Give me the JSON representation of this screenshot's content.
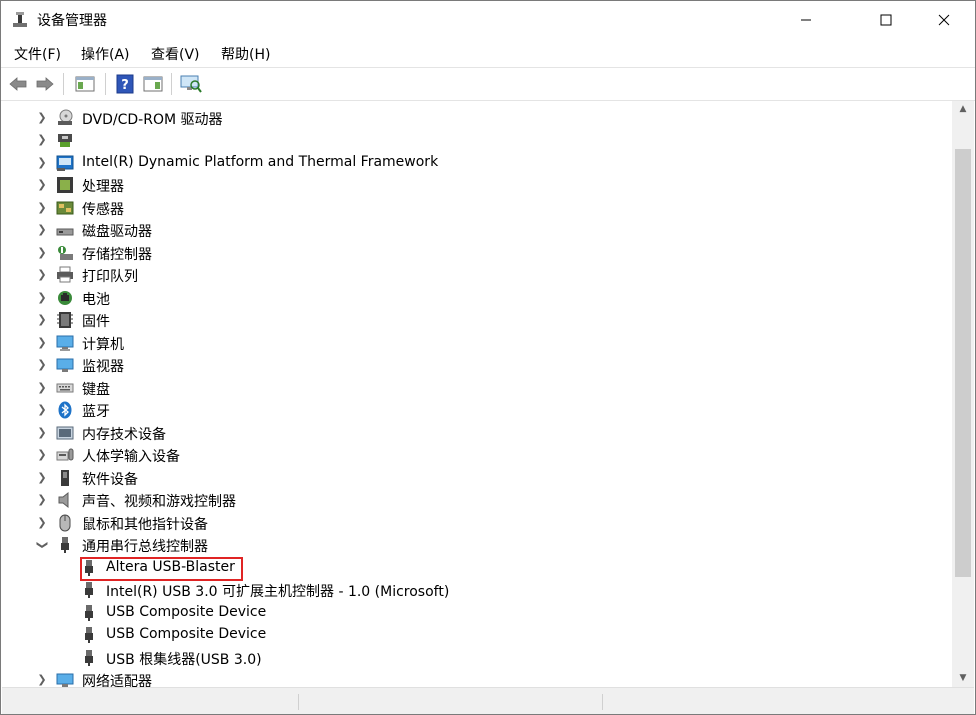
{
  "window": {
    "title": "设备管理器"
  },
  "menu": [
    {
      "label": "文件(F)"
    },
    {
      "label": "操作(A)"
    },
    {
      "label": "查看(V)"
    },
    {
      "label": "帮助(H)"
    }
  ],
  "tree": {
    "items": [
      {
        "label": "DVD/CD-ROM 驱动器",
        "icon": "dvd-drive-icon",
        "expanded": false
      },
      {
        "label": "",
        "icon": "network-board-icon",
        "expanded": false
      },
      {
        "label": "Intel(R) Dynamic Platform and Thermal Framework",
        "icon": "intel-dptf-icon",
        "expanded": false
      },
      {
        "label": "处理器",
        "icon": "processor-icon",
        "expanded": false
      },
      {
        "label": "传感器",
        "icon": "sensor-icon",
        "expanded": false
      },
      {
        "label": "磁盘驱动器",
        "icon": "disk-drive-icon",
        "expanded": false
      },
      {
        "label": "存储控制器",
        "icon": "storage-controller-icon",
        "expanded": false
      },
      {
        "label": "打印队列",
        "icon": "printer-icon",
        "expanded": false
      },
      {
        "label": "电池",
        "icon": "battery-icon",
        "expanded": false
      },
      {
        "label": "固件",
        "icon": "firmware-icon",
        "expanded": false
      },
      {
        "label": "计算机",
        "icon": "computer-icon",
        "expanded": false
      },
      {
        "label": "监视器",
        "icon": "monitor-icon",
        "expanded": false
      },
      {
        "label": "键盘",
        "icon": "keyboard-icon",
        "expanded": false
      },
      {
        "label": "蓝牙",
        "icon": "bluetooth-icon",
        "expanded": false
      },
      {
        "label": "内存技术设备",
        "icon": "memory-device-icon",
        "expanded": false
      },
      {
        "label": "人体学输入设备",
        "icon": "hid-icon",
        "expanded": false
      },
      {
        "label": "软件设备",
        "icon": "software-device-icon",
        "expanded": false
      },
      {
        "label": "声音、视频和游戏控制器",
        "icon": "speaker-icon",
        "expanded": false
      },
      {
        "label": "鼠标和其他指针设备",
        "icon": "mouse-icon",
        "expanded": false
      },
      {
        "label": "通用串行总线控制器",
        "icon": "usb-icon",
        "expanded": true
      },
      {
        "label": "网络适配器",
        "icon": "network-adapter-icon",
        "expanded": false
      }
    ],
    "usb_children": [
      {
        "label": "Altera USB-Blaster",
        "icon": "usb-icon",
        "highlighted": true
      },
      {
        "label": "Intel(R) USB 3.0 可扩展主机控制器 - 1.0 (Microsoft)",
        "icon": "usb-icon"
      },
      {
        "label": "USB Composite Device",
        "icon": "usb-icon"
      },
      {
        "label": "USB Composite Device",
        "icon": "usb-icon"
      },
      {
        "label": "USB 根集线器(USB 3.0)",
        "icon": "usb-icon"
      }
    ]
  },
  "colors": {
    "highlight_border": "#e02424",
    "icon_blue": "#1e73c8"
  }
}
